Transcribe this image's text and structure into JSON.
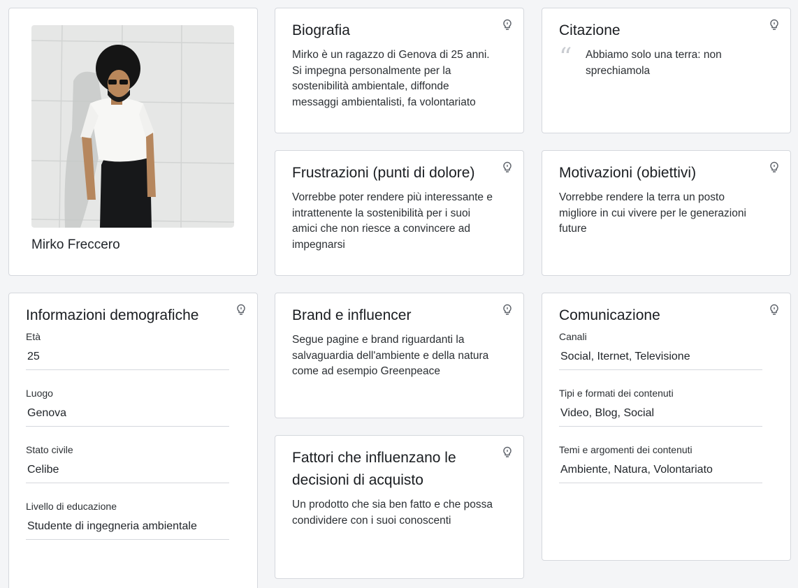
{
  "profile": {
    "name": "Mirko Freccero"
  },
  "bio": {
    "title": "Biografia",
    "text": "Mirko è un ragazzo di Genova di 25 anni. Si impegna personalmente per la sostenibilità ambientale, diffonde messaggi ambientalisti, fa volontariato"
  },
  "quote": {
    "title": "Citazione",
    "mark": "“",
    "text": "Abbiamo solo una terra: non sprechiamola"
  },
  "frustrations": {
    "title": "Frustrazioni (punti di dolore)",
    "text": "Vorrebbe poter rendere più interessante e intrattenente la sostenibilità per i suoi amici che non riesce a convincere ad impegnarsi"
  },
  "motivations": {
    "title": "Motivazioni (obiettivi)",
    "text": "Vorrebbe rendere la terra un posto migliore in cui vivere per le generazioni future"
  },
  "demographics": {
    "title": "Informazioni demografiche",
    "fields": [
      {
        "label": "Età",
        "value": "25"
      },
      {
        "label": "Luogo",
        "value": "Genova"
      },
      {
        "label": "Stato civile",
        "value": "Celibe"
      },
      {
        "label": "Livello di educazione",
        "value": "Studente di ingegneria ambientale"
      }
    ]
  },
  "brands": {
    "title": "Brand e influencer",
    "text": "Segue pagine e brand riguardanti la salvaguardia dell'ambiente e della natura come ad esempio Greenpeace"
  },
  "communication": {
    "title": "Comunicazione",
    "fields": [
      {
        "label": "Canali",
        "value": "Social, Iternet, Televisione"
      },
      {
        "label": "Tipi e formati dei contenuti",
        "value": "Video, Blog, Social"
      },
      {
        "label": "Temi e argomenti dei contenuti",
        "value": "Ambiente, Natura, Volontariato"
      }
    ]
  },
  "factors": {
    "title": "Fattori che influenzano le decisioni di acquisto",
    "text": "Un prodotto che sia ben fatto e che possa condividere con i suoi conoscenti"
  },
  "icons": {
    "hint": "lightbulb-icon",
    "quote": "quote-icon"
  },
  "colors": {
    "background": "#f4f5f7",
    "card": "#ffffff",
    "border": "#d5d8dd",
    "quote_mark": "#c9ccd1"
  }
}
